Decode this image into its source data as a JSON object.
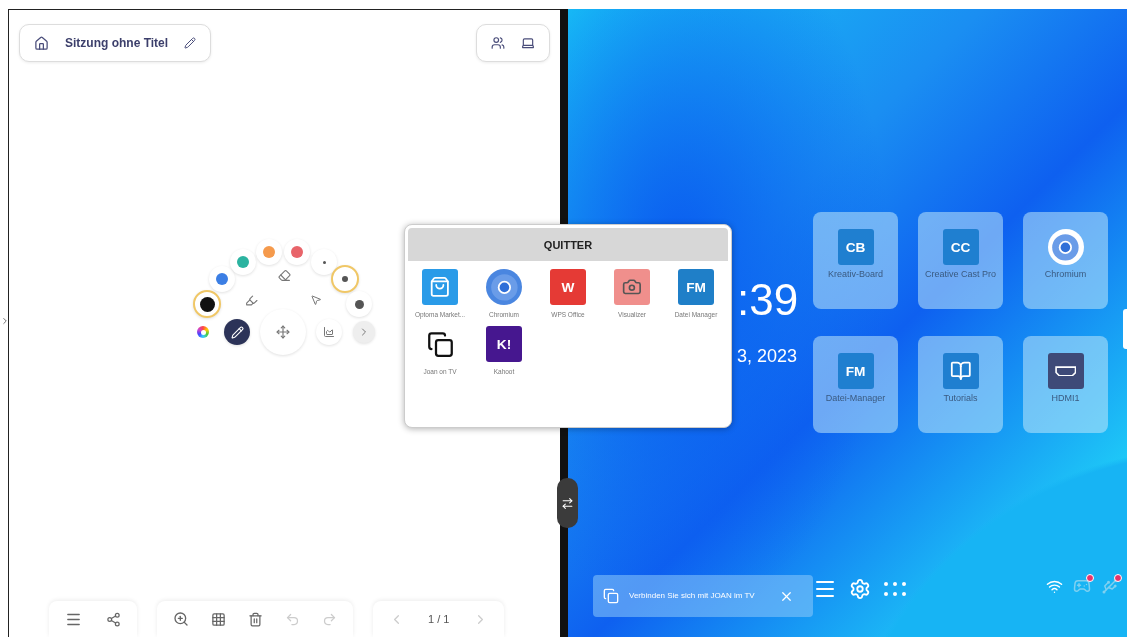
{
  "session": {
    "title": "Sitzung ohne Titel"
  },
  "pen_menu": {
    "colors": [
      {
        "color": "#111111",
        "selected": true
      },
      {
        "color": "#3b7ee4",
        "selected": false
      },
      {
        "color": "#2bb3a0",
        "selected": false
      },
      {
        "color": "#f59a4c",
        "selected": false
      },
      {
        "color": "#e8646a",
        "selected": false
      }
    ],
    "sizes": [
      {
        "selected": false
      },
      {
        "selected": true
      },
      {
        "selected": false
      }
    ]
  },
  "bottom_toolbar": {
    "page": "1 / 1"
  },
  "app_popup": {
    "title": "QUITTER",
    "apps": [
      {
        "name": "Optoma Market...",
        "kind": "store",
        "color": "#2a9be8"
      },
      {
        "name": "Chromium",
        "kind": "browser",
        "color": "#4a86e0"
      },
      {
        "name": "WPS Office",
        "kind": "letter",
        "logo": "W",
        "color": "#e53a35"
      },
      {
        "name": "Visualizer",
        "kind": "camera",
        "color": "#f08f8c"
      },
      {
        "name": "Datei Manager",
        "kind": "letter",
        "logo": "FM",
        "color": "#1f7fc8"
      },
      {
        "name": "Joan on TV",
        "kind": "joan",
        "color": "#ffffff"
      },
      {
        "name": "Kahoot",
        "kind": "letter",
        "logo": "K!",
        "color": "#46178f"
      }
    ]
  },
  "home": {
    "time": ":39",
    "date": "3, 2023",
    "tiles": [
      {
        "name": "Kreativ-Board",
        "kind": "letter",
        "logo": "CB",
        "color": "#1f7fd0"
      },
      {
        "name": "Creative Cast Pro",
        "kind": "letter",
        "logo": "CC",
        "color": "#1f7fd0"
      },
      {
        "name": "Chromium",
        "kind": "browser",
        "color": "#ffffff"
      },
      {
        "name": "Datei-Manager",
        "kind": "letter",
        "logo": "FM",
        "color": "#1f7fd0"
      },
      {
        "name": "Tutorials",
        "kind": "tutorial",
        "color": "#1f7fd0"
      },
      {
        "name": "HDMI1",
        "kind": "hdmi",
        "color": "#3e4a78"
      }
    ],
    "toast": {
      "message": "Verbinden Sie sich mit JOAN im TV"
    }
  }
}
